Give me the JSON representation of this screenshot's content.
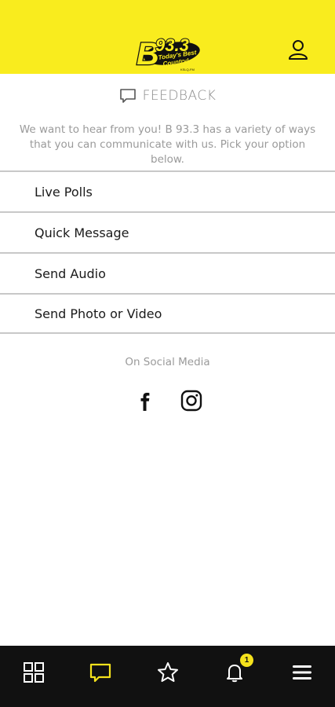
{
  "header": {
    "logo_main": "B93.3",
    "logo_tagline": "Today's Best Country!",
    "logo_callsign": "KSLQ-FM",
    "account_icon": "user-icon",
    "background_color": "#f9ec1e"
  },
  "page": {
    "title": "FEEDBACK",
    "title_icon": "chat-bubble-icon",
    "intro": "We want to hear from you! B 93.3 has a variety of ways that you can communicate with us. Pick your option below."
  },
  "options": [
    {
      "label": "Live Polls"
    },
    {
      "label": "Quick Message"
    },
    {
      "label": "Send Audio"
    },
    {
      "label": "Send Photo or Video"
    }
  ],
  "social": {
    "label": "On Social Media",
    "items": [
      {
        "icon": "facebook-icon"
      },
      {
        "icon": "instagram-icon"
      }
    ]
  },
  "bottom_nav": {
    "background_color": "#111111",
    "active_color": "#f5e21c",
    "items": [
      {
        "icon": "grid-icon",
        "active": false
      },
      {
        "icon": "chat-bubble-icon",
        "active": true
      },
      {
        "icon": "star-icon",
        "active": false
      },
      {
        "icon": "bell-icon",
        "active": false
      },
      {
        "icon": "hamburger-menu-icon",
        "active": false
      }
    ],
    "notification_count": "1"
  }
}
